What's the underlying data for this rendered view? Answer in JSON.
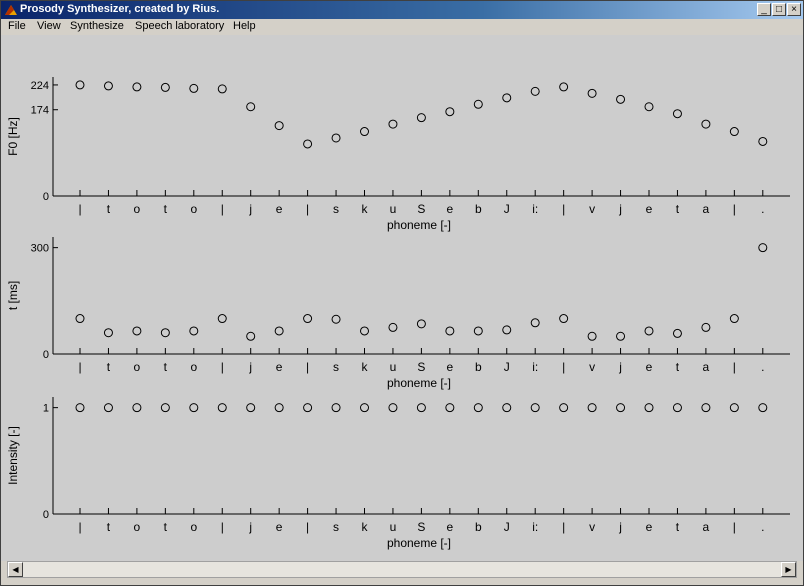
{
  "window": {
    "title": "Prosody Synthesizer, created by Rius.",
    "minimize_glyph": "_",
    "maximize_glyph": "□",
    "close_glyph": "×",
    "icon": "matlab-icon"
  },
  "menu": [
    "File",
    "View",
    "Synthesize",
    "Speech laboratory",
    "Help"
  ],
  "phonemes": [
    "|",
    "t",
    "o",
    "t",
    "o",
    "|",
    "j",
    "e",
    "|",
    "s",
    "k",
    "u",
    "S",
    "e",
    "b",
    "J",
    "i:",
    "|",
    "v",
    "j",
    "e",
    "t",
    "a",
    "|",
    "."
  ],
  "chart_data": [
    {
      "type": "scatter",
      "name": "f0",
      "ylabel": "F0 [Hz]",
      "xlabel": "phoneme [-]",
      "yticks": [
        0,
        174,
        224
      ],
      "ylim": [
        0,
        240
      ],
      "values": [
        224,
        222,
        220,
        219,
        217,
        216,
        180,
        142,
        105,
        117,
        130,
        145,
        158,
        170,
        185,
        198,
        211,
        220,
        207,
        195,
        180,
        166,
        145,
        130,
        110
      ]
    },
    {
      "type": "scatter",
      "name": "duration",
      "ylabel": "t [ms]",
      "xlabel": "phoneme [-]",
      "yticks": [
        0,
        300
      ],
      "ylim": [
        0,
        330
      ],
      "values": [
        100,
        60,
        65,
        60,
        65,
        100,
        50,
        65,
        100,
        98,
        65,
        75,
        85,
        65,
        65,
        68,
        88,
        100,
        50,
        50,
        65,
        58,
        75,
        100,
        300
      ]
    },
    {
      "type": "scatter",
      "name": "intensity",
      "ylabel": "Intensity [-]",
      "xlabel": "phoneme [-]",
      "yticks": [
        0,
        1
      ],
      "ylim": [
        0,
        1.1
      ],
      "values": [
        1,
        1,
        1,
        1,
        1,
        1,
        1,
        1,
        1,
        1,
        1,
        1,
        1,
        1,
        1,
        1,
        1,
        1,
        1,
        1,
        1,
        1,
        1,
        1,
        1
      ]
    }
  ],
  "scrollbar": {
    "left_arrow": "◀",
    "right_arrow": "▶"
  }
}
